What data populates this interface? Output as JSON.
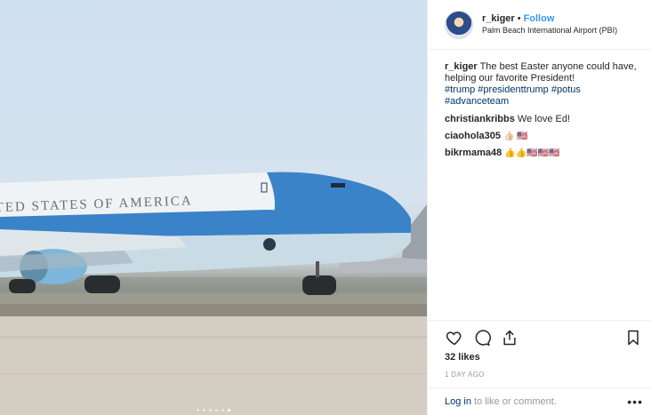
{
  "post": {
    "username": "r_kiger",
    "separator": "•",
    "follow_label": "Follow",
    "location": "Palm Beach International Airport (PBI)",
    "avatar_icon": "profile-avatar",
    "aircraft_lettering": "UNITED STATES OF AMERICA"
  },
  "caption": {
    "username": "r_kiger",
    "text": "The best Easter anyone could have, helping our favorite President!",
    "hashtags": "#trump #presidenttrump #potus #advanceteam"
  },
  "comments": [
    {
      "username": "christiankribbs",
      "text": "We love Ed!"
    },
    {
      "username": "ciaohola305",
      "text": "👍🏻 🇺🇸"
    },
    {
      "username": "bikrmama48",
      "text": "👍👍🇺🇸🇺🇸🇺🇸"
    }
  ],
  "actions": {
    "like_icon": "heart-icon",
    "comment_icon": "comment-icon",
    "share_icon": "share-icon",
    "save_icon": "bookmark-icon"
  },
  "likes": "32 likes",
  "timestamp": "1 DAY AGO",
  "footer": {
    "login_label": "Log in",
    "login_rest": "to like or comment.",
    "more_label": "•••"
  },
  "carousel": {
    "count": 6,
    "active_index": 5
  },
  "colors": {
    "link_blue": "#3897f0",
    "hashtag_blue": "#003569",
    "aircraft_blue": "#3a83c8",
    "muted_gray": "#999999"
  }
}
